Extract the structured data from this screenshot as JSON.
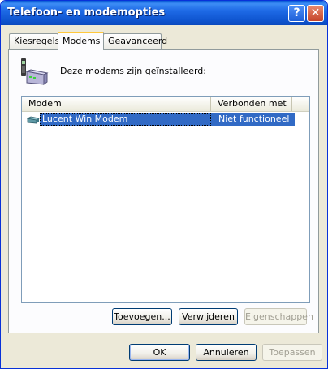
{
  "window": {
    "title": "Telefoon- en modemopties",
    "help_label": "?",
    "close_label": "✕"
  },
  "tabs": [
    {
      "label": "Kiesregels"
    },
    {
      "label": "Modems",
      "active": true
    },
    {
      "label": "Geavanceerd"
    }
  ],
  "panel": {
    "intro": "Deze modems zijn geïnstalleerd:",
    "icon": "modem-phone-icon"
  },
  "listview": {
    "columns": [
      "Modem",
      "Verbonden met"
    ],
    "rows": [
      {
        "icon": "modem-icon",
        "modem": "Lucent Win Modem",
        "connected": "Niet functioneel",
        "selected": true
      }
    ]
  },
  "panel_buttons": {
    "add": "Toevoegen...",
    "remove": "Verwijderen",
    "properties": "Eigenschappen"
  },
  "dialog_buttons": {
    "ok": "OK",
    "cancel": "Annuleren",
    "apply": "Toepassen"
  },
  "colors": {
    "titlebar": "#0a5bd6",
    "selection": "#316ac5",
    "tab_highlight": "#ffc83c",
    "dialog_bg": "#ece9d8"
  }
}
